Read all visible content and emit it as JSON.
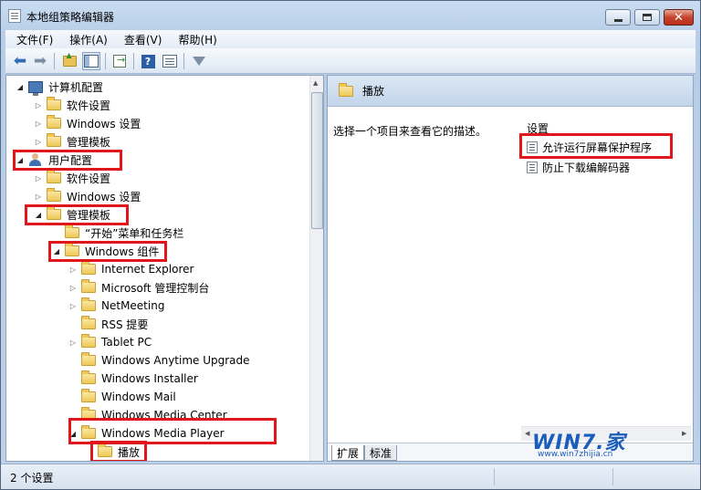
{
  "window": {
    "title": "本地组策略编辑器",
    "min_glyph": "",
    "close_glyph": "✕"
  },
  "menu": [
    "文件(F)",
    "操作(A)",
    "查看(V)",
    "帮助(H)"
  ],
  "toolbar": {
    "icons": [
      "back-icon",
      "forward-icon",
      "up-folder-icon",
      "show-tree-icon",
      "export-list-icon",
      "help-icon",
      "view-icon",
      "filter-icon"
    ]
  },
  "tree": [
    {
      "label": "计算机配置",
      "icon": "computer",
      "expander": "◢"
    },
    {
      "label": "软件设置",
      "icon": "folder",
      "expander": "▷"
    },
    {
      "label": "Windows 设置",
      "icon": "folder",
      "expander": "▷"
    },
    {
      "label": "管理模板",
      "icon": "folder",
      "expander": "▷"
    },
    {
      "label": "用户配置",
      "icon": "user",
      "expander": "◢"
    },
    {
      "label": "软件设置",
      "icon": "folder",
      "expander": "▷"
    },
    {
      "label": "Windows 设置",
      "icon": "folder",
      "expander": "▷"
    },
    {
      "label": "管理模板",
      "icon": "folder",
      "expander": "◢"
    },
    {
      "label": "“开始”菜单和任务栏",
      "icon": "folder",
      "expander": ""
    },
    {
      "label": "Windows 组件",
      "icon": "folder",
      "expander": "◢"
    },
    {
      "label": "Internet Explorer",
      "icon": "folder",
      "expander": "▷"
    },
    {
      "label": "Microsoft 管理控制台",
      "icon": "folder",
      "expander": "▷"
    },
    {
      "label": "NetMeeting",
      "icon": "folder",
      "expander": "▷"
    },
    {
      "label": "RSS 提要",
      "icon": "folder",
      "expander": ""
    },
    {
      "label": "Tablet PC",
      "icon": "folder",
      "expander": "▷"
    },
    {
      "label": "Windows Anytime Upgrade",
      "icon": "folder",
      "expander": ""
    },
    {
      "label": "Windows Installer",
      "icon": "folder",
      "expander": ""
    },
    {
      "label": "Windows Mail",
      "icon": "folder",
      "expander": ""
    },
    {
      "label": "Windows Media Center",
      "icon": "folder",
      "expander": ""
    },
    {
      "label": "Windows Media Player",
      "icon": "folder",
      "expander": "◢"
    },
    {
      "label": "播放",
      "icon": "folder",
      "expander": ""
    }
  ],
  "right": {
    "header_title": "播放",
    "description": "选择一个项目来查看它的描述。",
    "column_header": "设置",
    "settings": [
      "允许运行屏幕保护程序",
      "防止下载编解码器"
    ],
    "tabs": [
      "扩展",
      "标准"
    ]
  },
  "status": {
    "text": "2 个设置"
  },
  "watermark": {
    "brand": "WIN7.家",
    "url": "www.win7zhijia.cn"
  },
  "colors": {
    "highlight": "#e0161b",
    "titlebar": "#c9dcf0",
    "close_button": "#c7432d"
  }
}
